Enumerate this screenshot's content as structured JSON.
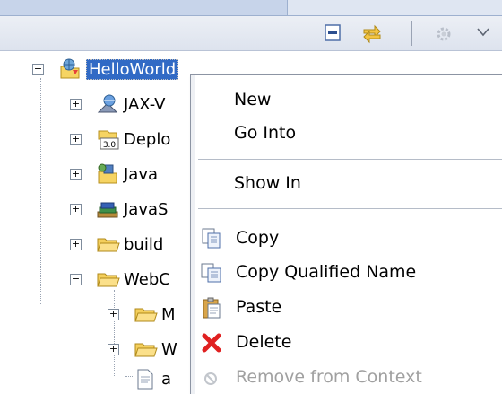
{
  "toolbar": {
    "buttons": [
      {
        "icon": "collapse-all-icon"
      },
      {
        "icon": "link-with-editor-icon"
      },
      {
        "icon": "gear-icon"
      },
      {
        "icon": "view-menu-chevron-icon"
      }
    ]
  },
  "tree": {
    "items": [
      {
        "label": "HelloWorld",
        "icon": "web-project-icon",
        "expanded": true,
        "selected": true
      },
      {
        "label": "JAX-V",
        "icon": "jax-ws-icon",
        "expanded": false
      },
      {
        "label": "Deplo",
        "icon": "deployment-descriptor-icon",
        "expanded": false,
        "badge": "3.0"
      },
      {
        "label": "Java",
        "icon": "java-resources-icon",
        "expanded": false
      },
      {
        "label": "JavaS",
        "icon": "javascript-resources-icon",
        "expanded": false
      },
      {
        "label": "build",
        "icon": "folder-icon",
        "expanded": false
      },
      {
        "label": "WebC",
        "icon": "folder-icon",
        "expanded": true
      },
      {
        "label": "M",
        "icon": "folder-icon",
        "expanded": false
      },
      {
        "label": "W",
        "icon": "folder-icon",
        "expanded": false
      },
      {
        "label": "a",
        "icon": "file-icon"
      }
    ]
  },
  "context_menu": {
    "items": [
      {
        "label": "New"
      },
      {
        "label": "Go Into"
      },
      {
        "label": "Show In"
      },
      {
        "label": "Copy",
        "icon": "copy-icon"
      },
      {
        "label": "Copy Qualified Name",
        "icon": "copy-qualified-name-icon"
      },
      {
        "label": "Paste",
        "icon": "paste-icon"
      },
      {
        "label": "Delete",
        "icon": "delete-icon"
      },
      {
        "label": "Remove from Context",
        "icon": "remove-from-context-icon",
        "disabled": true
      }
    ]
  },
  "colors": {
    "selection": "#316ac5",
    "menu_separator": "#b5bcc8",
    "disabled_text": "#a0a0a0",
    "delete_red": "#e02020"
  }
}
